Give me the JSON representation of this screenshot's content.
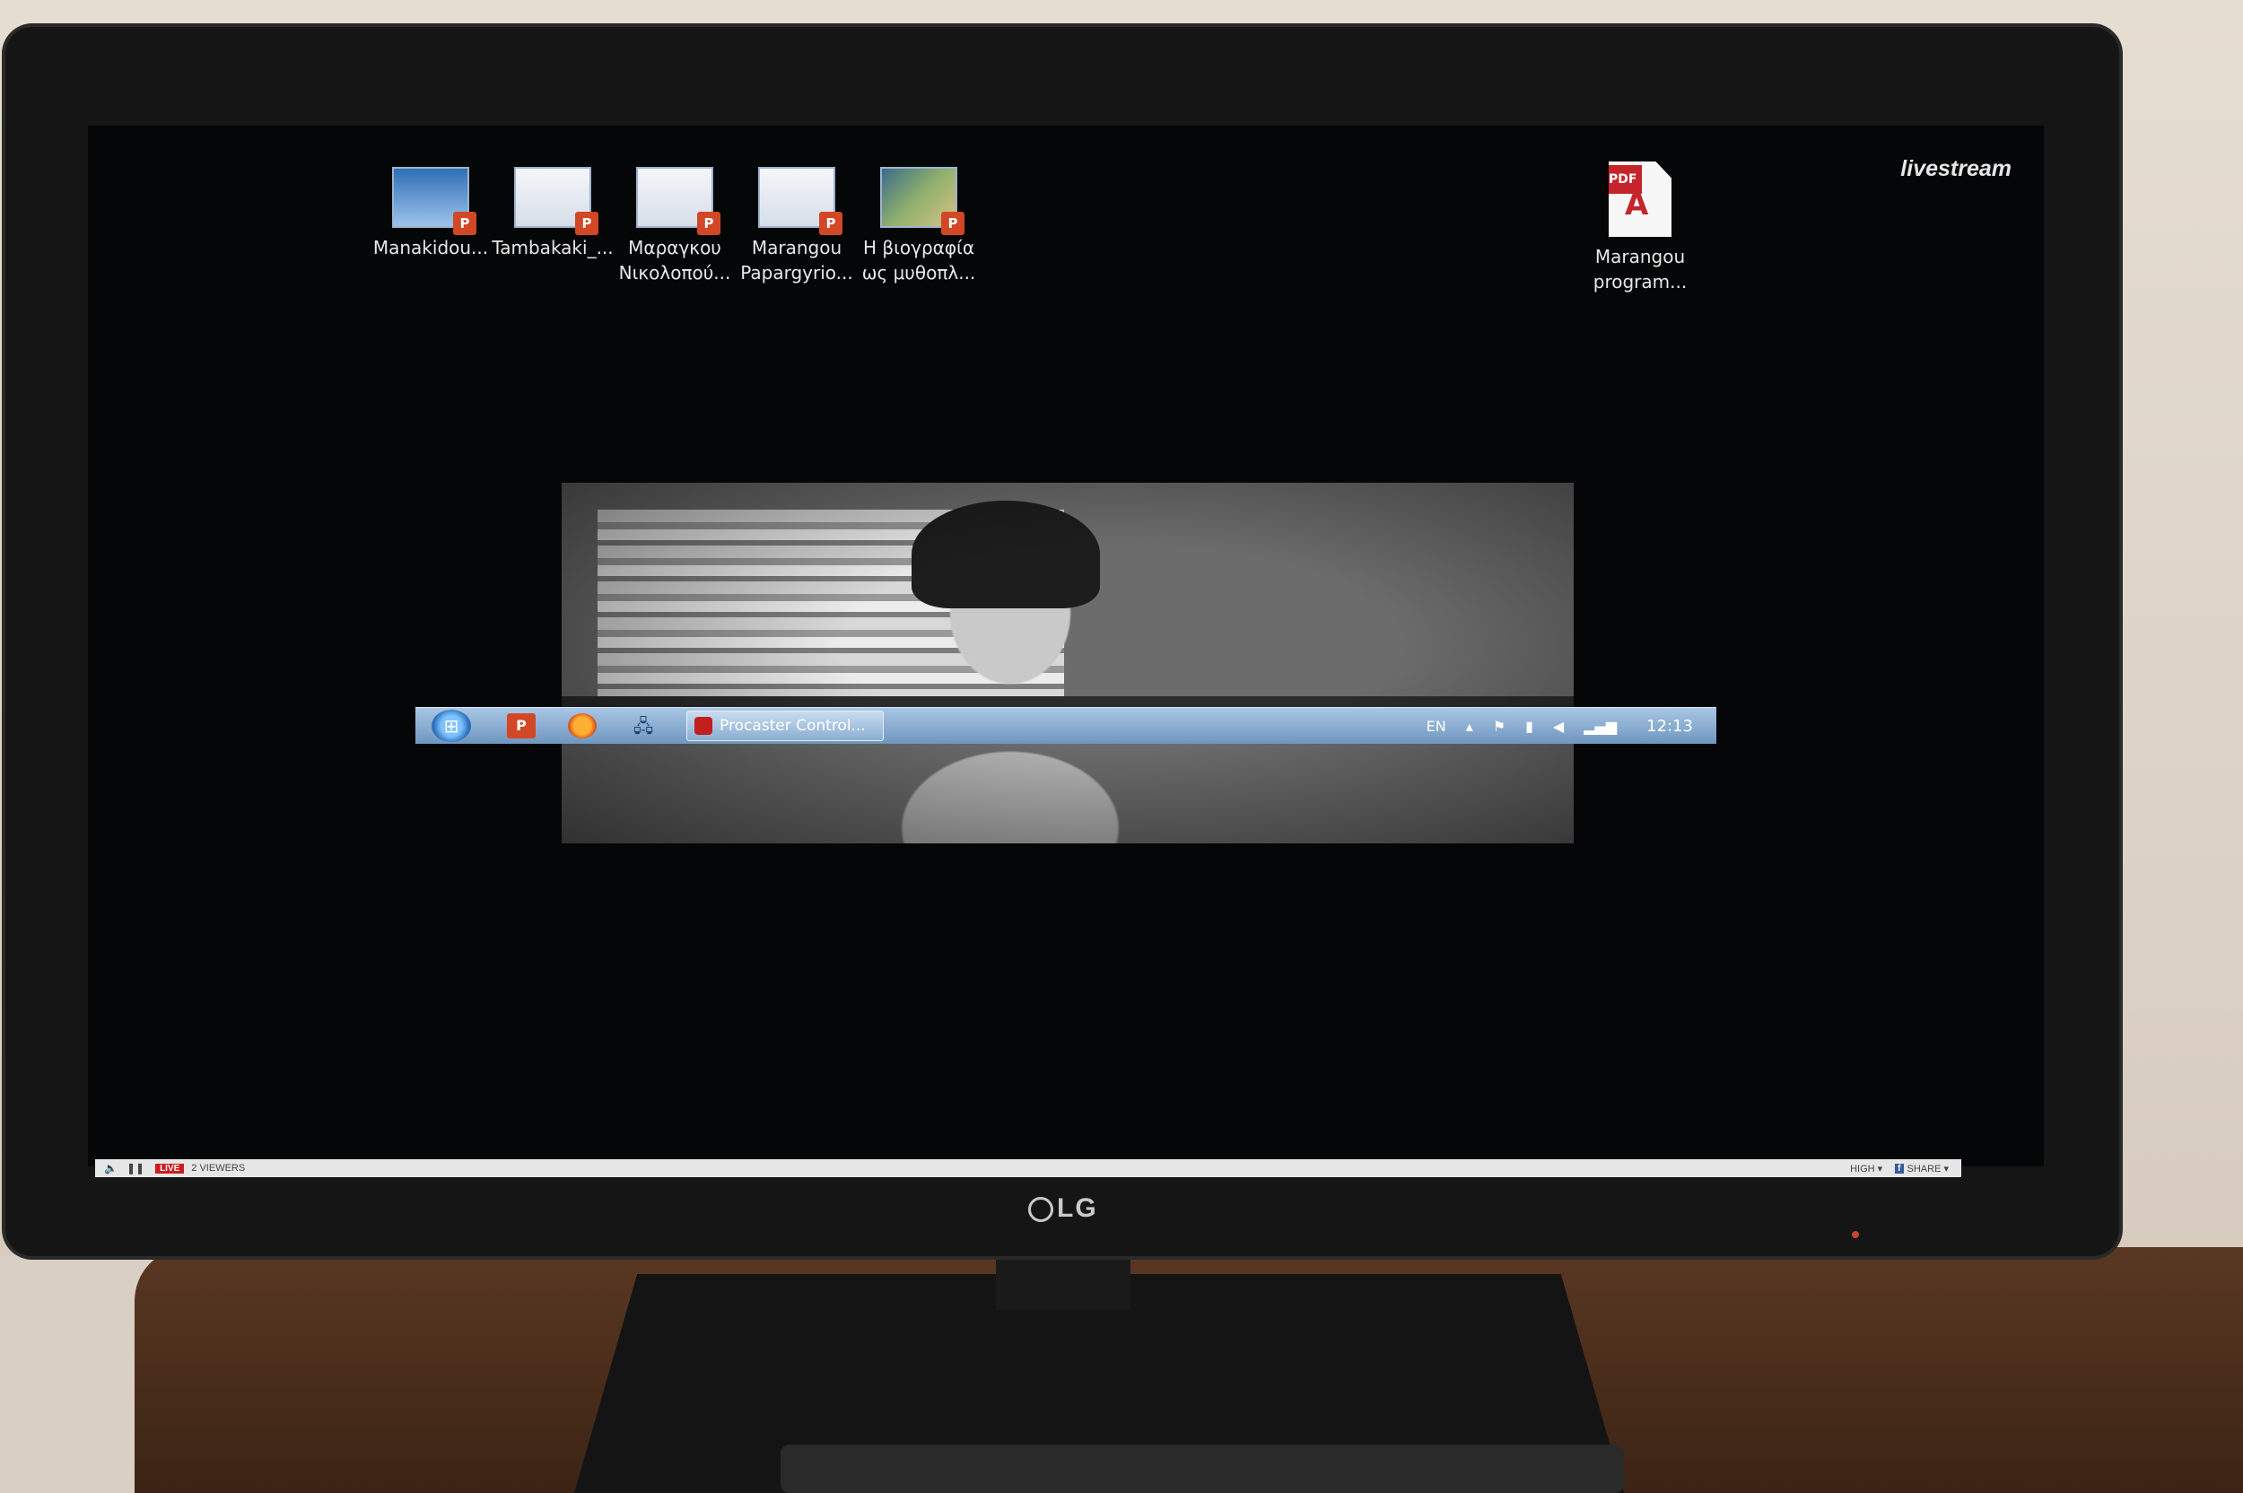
{
  "desktop": {
    "icons": [
      {
        "line1": "Manakidou...",
        "line2": "",
        "kind": "ppt",
        "thumb": "blue"
      },
      {
        "line1": "Tambakaki_...",
        "line2": "",
        "kind": "ppt",
        "thumb": "light"
      },
      {
        "line1": "Μαραγκου",
        "line2": "Νικολοπού...",
        "kind": "ppt",
        "thumb": "light"
      },
      {
        "line1": "Marangou",
        "line2": "Papargyrio...",
        "kind": "ppt",
        "thumb": "light"
      },
      {
        "line1": "Η βιογραφία",
        "line2": "ως μυθοπλ...",
        "kind": "ppt",
        "thumb": "photo"
      }
    ],
    "pdf_icon": {
      "tag": "PDF",
      "line1": "Marangou",
      "line2": "program..."
    },
    "brand": "livestream"
  },
  "taskbar": {
    "start_icon": "windows-start-orb",
    "pinned": [
      "powerpoint-icon",
      "firefox-icon",
      "network-icon"
    ],
    "active_task": "Procaster Control...",
    "tray": {
      "language": "EN",
      "clock": "12:13"
    }
  },
  "livestream_bar": {
    "live_label": "LIVE",
    "viewers": "2 VIEWERS",
    "quality": "HIGH ▾",
    "share": "SHARE ▾"
  },
  "monitor": {
    "brand": "LG"
  }
}
